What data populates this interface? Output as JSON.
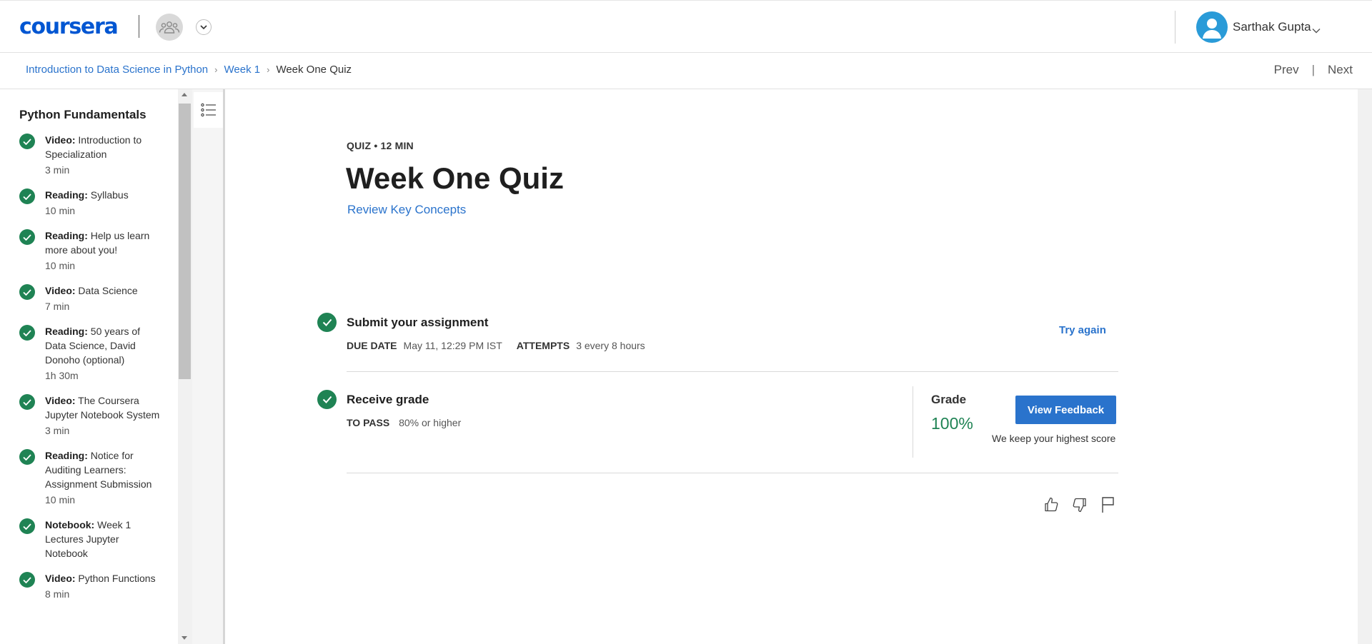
{
  "header": {
    "logo": "coursera",
    "team_icon": "team-icon",
    "dropdown_icon": "chevron-down-icon",
    "user_name": "Sarthak Gupta",
    "avatar_icon": "user-avatar-icon",
    "colors": {
      "brand": "#0056d2",
      "avatar": "#2a9bd8"
    }
  },
  "breadcrumb": {
    "items": [
      "Introduction to Data Science in Python",
      "Week 1",
      "Week One Quiz"
    ],
    "prev": "Prev",
    "next": "Next",
    "separator": "|"
  },
  "sidebar": {
    "title": "Python Fundamentals",
    "items": [
      {
        "kind": "Video:",
        "title": "Introduction to Specialization",
        "duration": "3 min",
        "completed": true
      },
      {
        "kind": "Reading:",
        "title": "Syllabus",
        "duration": "10 min",
        "completed": true
      },
      {
        "kind": "Reading:",
        "title": "Help us learn more about you!",
        "duration": "10 min",
        "completed": true
      },
      {
        "kind": "Video:",
        "title": "Data Science",
        "duration": "7 min",
        "completed": true
      },
      {
        "kind": "Reading:",
        "title": "50 years of Data Science, David Donoho (optional)",
        "duration": "1h 30m",
        "completed": true
      },
      {
        "kind": "Video:",
        "title": "The Coursera Jupyter Notebook System",
        "duration": "3 min",
        "completed": true
      },
      {
        "kind": "Reading:",
        "title": "Notice for Auditing Learners: Assignment Submission",
        "duration": "10 min",
        "completed": true
      },
      {
        "kind": "Notebook:",
        "title": "Week 1 Lectures Jupyter Notebook",
        "duration": "",
        "completed": true
      },
      {
        "kind": "Video:",
        "title": "Python Functions",
        "duration": "8 min",
        "completed": true
      }
    ],
    "toggle_icon": "list-icon"
  },
  "main": {
    "eyebrow": "QUIZ • 12 MIN",
    "title": "Week One Quiz",
    "review_link": "Review Key Concepts",
    "submit": {
      "title": "Submit your assignment",
      "due_label": "DUE DATE",
      "due_value": "May 11, 12:29 PM IST",
      "attempts_label": "ATTEMPTS",
      "attempts_value": "3 every 8 hours",
      "action": "Try again"
    },
    "grade": {
      "title": "Receive grade",
      "pass_label": "TO PASS",
      "pass_value": "80% or higher",
      "grade_label": "Grade",
      "grade_value": "100%",
      "button": "View Feedback",
      "note": "We keep your highest score"
    },
    "feedback_icons": [
      "thumbs-up-icon",
      "thumbs-down-icon",
      "flag-icon"
    ],
    "colors": {
      "success": "#1f8354",
      "link": "#2a73cc",
      "button": "#2a73cc"
    }
  }
}
